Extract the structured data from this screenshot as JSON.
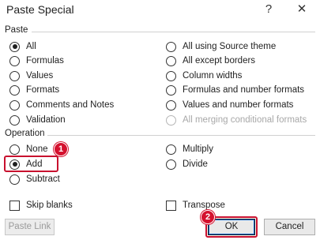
{
  "dialog": {
    "title": "Paste Special",
    "help_glyph": "?",
    "close_glyph": "✕"
  },
  "paste": {
    "label": "Paste",
    "left": [
      {
        "label": "All",
        "checked": true
      },
      {
        "label": "Formulas",
        "checked": false
      },
      {
        "label": "Values",
        "checked": false
      },
      {
        "label": "Formats",
        "checked": false
      },
      {
        "label": "Comments and Notes",
        "checked": false
      },
      {
        "label": "Validation",
        "checked": false
      }
    ],
    "right": [
      {
        "label": "All using Source theme",
        "checked": false
      },
      {
        "label": "All except borders",
        "checked": false
      },
      {
        "label": "Column widths",
        "checked": false
      },
      {
        "label": "Formulas and number formats",
        "checked": false
      },
      {
        "label": "Values and number formats",
        "checked": false
      },
      {
        "label": "All merging conditional formats",
        "checked": false,
        "disabled": true
      }
    ]
  },
  "operation": {
    "label": "Operation",
    "left": [
      {
        "label": "None",
        "checked": false
      },
      {
        "label": "Add",
        "checked": true
      },
      {
        "label": "Subtract",
        "checked": false
      }
    ],
    "right": [
      {
        "label": "Multiply",
        "checked": false
      },
      {
        "label": "Divide",
        "checked": false
      }
    ]
  },
  "options": {
    "skip_blanks": "Skip blanks",
    "transpose": "Transpose"
  },
  "buttons": {
    "paste_link": "Paste Link",
    "ok": "OK",
    "cancel": "Cancel"
  },
  "annotations": {
    "badge_1": "1",
    "badge_2": "2",
    "color": "#d4112e"
  }
}
